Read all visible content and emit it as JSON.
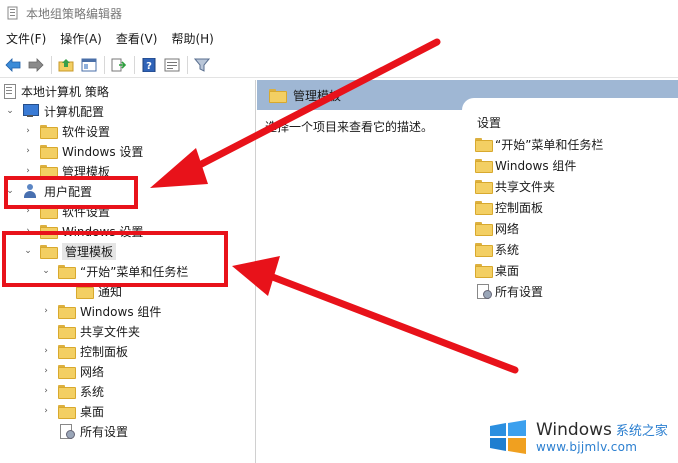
{
  "window": {
    "title": "本地组策略编辑器"
  },
  "menu": [
    "文件(F)",
    "操作(A)",
    "查看(V)",
    "帮助(H)"
  ],
  "tree": [
    {
      "label": "本地计算机 策略",
      "icon": "policy-icon",
      "expander": ""
    },
    {
      "label": "计算机配置",
      "icon": "computer-icon",
      "expander": "⌄"
    },
    {
      "label": "软件设置",
      "icon": "folder-icon",
      "expander": "›"
    },
    {
      "label": "Windows 设置",
      "icon": "folder-icon",
      "expander": "›"
    },
    {
      "label": "管理模板",
      "icon": "folder-icon",
      "expander": "›"
    },
    {
      "label": "用户配置",
      "icon": "user-icon",
      "expander": "⌄"
    },
    {
      "label": "软件设置",
      "icon": "folder-icon",
      "expander": "›"
    },
    {
      "label": "Windows 设置",
      "icon": "folder-icon",
      "expander": "›"
    },
    {
      "label": "管理模板",
      "icon": "folder-icon",
      "expander": "⌄",
      "selected": true
    },
    {
      "label": "“开始”菜单和任务栏",
      "icon": "folder-icon",
      "expander": "⌄"
    },
    {
      "label": "通知",
      "icon": "folder-icon",
      "expander": ""
    },
    {
      "label": "Windows 组件",
      "icon": "folder-icon",
      "expander": "›"
    },
    {
      "label": "共享文件夹",
      "icon": "folder-icon",
      "expander": ""
    },
    {
      "label": "控制面板",
      "icon": "folder-icon",
      "expander": "›"
    },
    {
      "label": "网络",
      "icon": "folder-icon",
      "expander": "›"
    },
    {
      "label": "系统",
      "icon": "folder-icon",
      "expander": "›"
    },
    {
      "label": "桌面",
      "icon": "folder-icon",
      "expander": "›"
    },
    {
      "label": "所有设置",
      "icon": "settings-icon",
      "expander": ""
    }
  ],
  "right": {
    "header": "管理模板",
    "description": "选择一个项目来查看它的描述。",
    "list_header": "设置",
    "items": [
      {
        "label": "“开始”菜单和任务栏",
        "icon": "folder-icon"
      },
      {
        "label": "Windows 组件",
        "icon": "folder-icon"
      },
      {
        "label": "共享文件夹",
        "icon": "folder-icon"
      },
      {
        "label": "控制面板",
        "icon": "folder-icon"
      },
      {
        "label": "网络",
        "icon": "folder-icon"
      },
      {
        "label": "系统",
        "icon": "folder-icon"
      },
      {
        "label": "桌面",
        "icon": "folder-icon"
      },
      {
        "label": "所有设置",
        "icon": "settings-icon"
      }
    ]
  },
  "watermark": {
    "brand": "Windows",
    "cn": "系统之家",
    "url": "www.bjjmlv.com"
  },
  "colors": {
    "annotation_red": "#e8121a",
    "header_blue": "#9fb7d4"
  }
}
